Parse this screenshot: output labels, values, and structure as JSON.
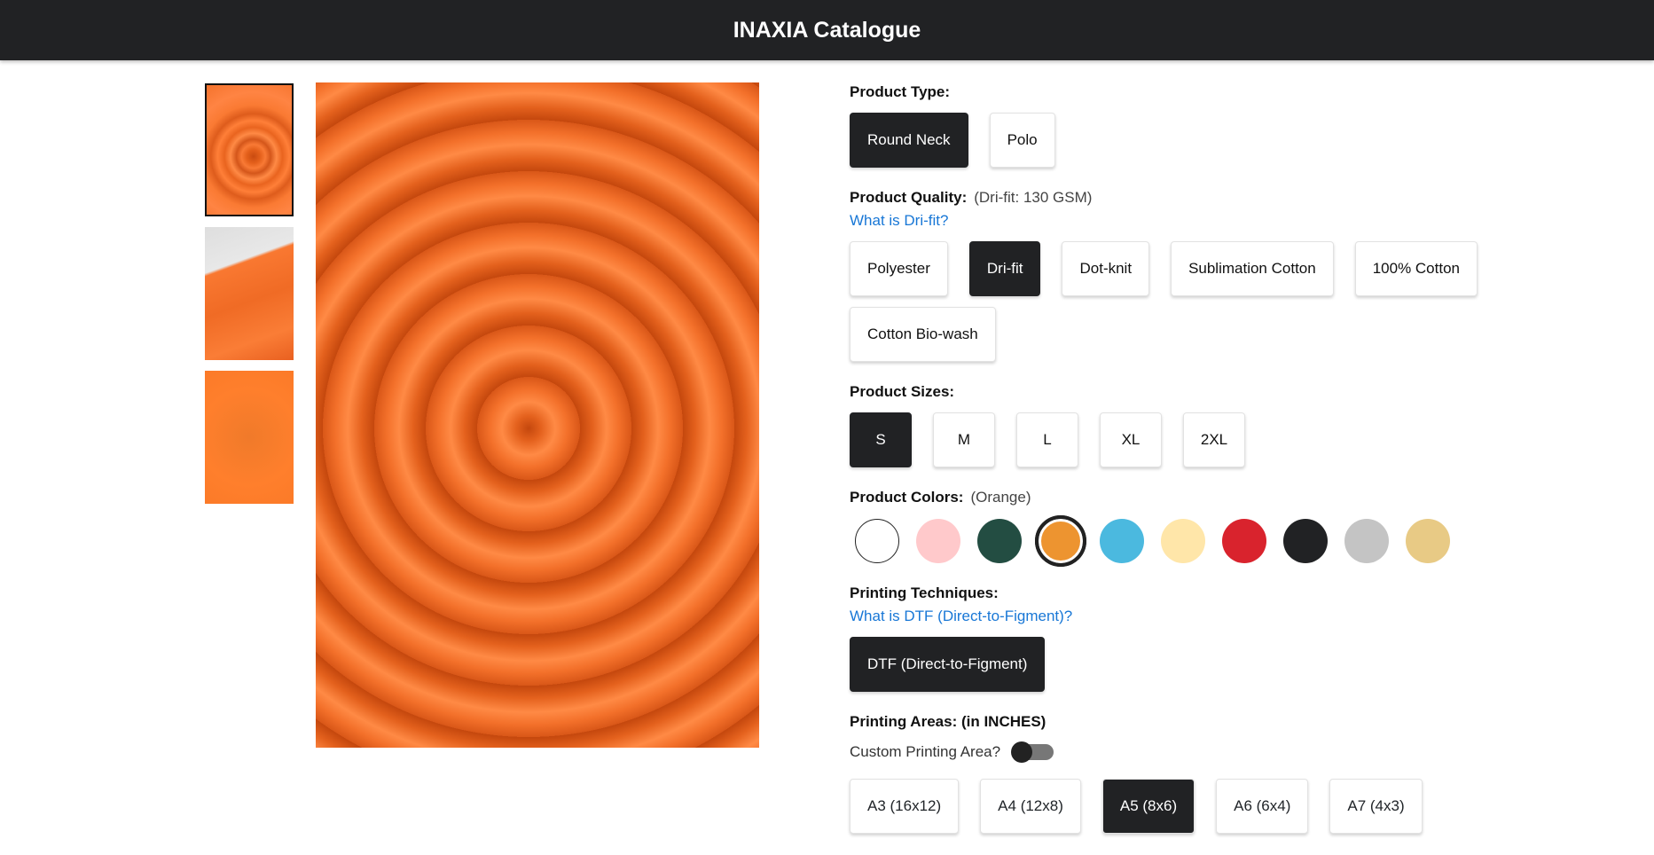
{
  "app": {
    "title": "INAXIA Catalogue"
  },
  "thumbnails": [
    {
      "name": "swirl-fabric",
      "active": true
    },
    {
      "name": "folded-fabric",
      "active": false
    },
    {
      "name": "flat-fabric",
      "active": false
    }
  ],
  "product_type": {
    "label": "Product Type:",
    "options": [
      "Round Neck",
      "Polo"
    ],
    "selected": "Round Neck"
  },
  "product_quality": {
    "label": "Product Quality:",
    "current": "(Dri-fit: 130 GSM)",
    "help_link": "What is Dri-fit?",
    "options": [
      "Polyester",
      "Dri-fit",
      "Dot-knit",
      "Sublimation Cotton",
      "100% Cotton",
      "Cotton Bio-wash"
    ],
    "selected": "Dri-fit"
  },
  "product_sizes": {
    "label": "Product Sizes:",
    "options": [
      "S",
      "M",
      "L",
      "XL",
      "2XL"
    ],
    "selected": "S"
  },
  "product_colors": {
    "label": "Product Colors:",
    "current": "(Orange)",
    "swatches": [
      "#ffffff",
      "#ffc9cb",
      "#234d42",
      "#ed9430",
      "#4bb9df",
      "#ffe6a9",
      "#d9232d",
      "#212224",
      "#c4c4c4",
      "#e8ca85"
    ],
    "selected_index": 3
  },
  "printing_techniques": {
    "label": "Printing Techniques:",
    "help_link": "What is DTF (Direct-to-Figment)?",
    "options": [
      "DTF (Direct-to-Figment)"
    ],
    "selected": "DTF (Direct-to-Figment)"
  },
  "printing_areas": {
    "label": "Printing Areas: (in INCHES)",
    "custom_label": "Custom Printing Area?",
    "custom_enabled": false,
    "options": [
      "A3 (16x12)",
      "A4 (12x8)",
      "A5 (8x6)",
      "A6 (6x4)",
      "A7 (4x3)"
    ],
    "selected": "A5 (8x6)"
  }
}
